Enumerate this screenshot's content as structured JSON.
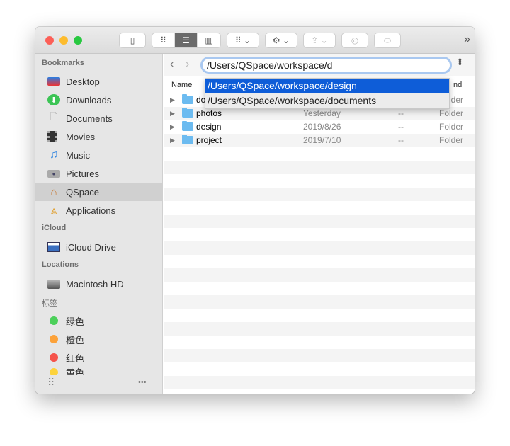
{
  "toolbar": {
    "overflow": "»"
  },
  "path": {
    "value": "/Users/QSpace/workspace/d"
  },
  "sidebar": {
    "sections": [
      {
        "title": "Bookmarks",
        "items": [
          {
            "label": "Desktop",
            "icon": "desktop-icon"
          },
          {
            "label": "Downloads",
            "icon": "downloads-icon"
          },
          {
            "label": "Documents",
            "icon": "documents-icon"
          },
          {
            "label": "Movies",
            "icon": "movies-icon"
          },
          {
            "label": "Music",
            "icon": "music-icon"
          },
          {
            "label": "Pictures",
            "icon": "pictures-icon"
          },
          {
            "label": "QSpace",
            "icon": "home-icon",
            "selected": true
          },
          {
            "label": "Applications",
            "icon": "applications-icon"
          }
        ]
      },
      {
        "title": "iCloud",
        "items": [
          {
            "label": "iCloud Drive",
            "icon": "icloud-drive-icon"
          }
        ]
      },
      {
        "title": "Locations",
        "items": [
          {
            "label": "Macintosh HD",
            "icon": "hard-drive-icon"
          }
        ]
      },
      {
        "title": "标签",
        "items": [
          {
            "label": "绿色",
            "color": "#4cd05a"
          },
          {
            "label": "橙色",
            "color": "#fca23a"
          },
          {
            "label": "红色",
            "color": "#f5534b"
          },
          {
            "label": "黄色",
            "color": "#fdd33c"
          }
        ]
      }
    ],
    "more": "•••"
  },
  "columns": {
    "name": "Name",
    "kind": "nd"
  },
  "files": [
    {
      "name": "do",
      "date": "",
      "size": "",
      "kind": "Folder"
    },
    {
      "name": "photos",
      "date": "Yesterday",
      "size": "--",
      "kind": "Folder"
    },
    {
      "name": "design",
      "date": "2019/8/26",
      "size": "--",
      "kind": "Folder"
    },
    {
      "name": "project",
      "date": "2019/7/10",
      "size": "--",
      "kind": "Folder"
    }
  ],
  "autocomplete": [
    "/Users/QSpace/workspace/design",
    "/Users/QSpace/workspace/documents"
  ],
  "colors": {
    "selection": "#0e5dd8",
    "folder": "#6cbbf0"
  }
}
